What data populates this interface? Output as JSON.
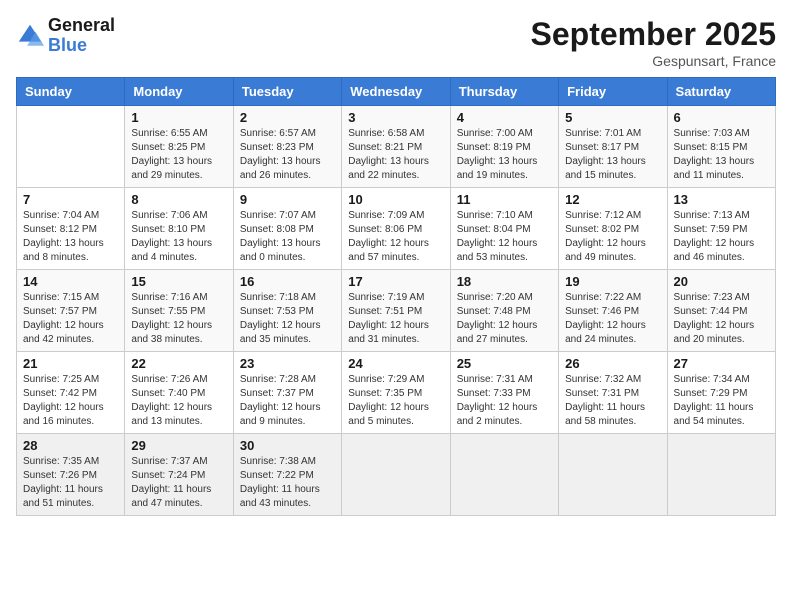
{
  "logo": {
    "text_general": "General",
    "text_blue": "Blue"
  },
  "title": "September 2025",
  "location": "Gespunsart, France",
  "weekdays": [
    "Sunday",
    "Monday",
    "Tuesday",
    "Wednesday",
    "Thursday",
    "Friday",
    "Saturday"
  ],
  "weeks": [
    [
      {
        "day": "",
        "sunrise": "",
        "sunset": "",
        "daylight": ""
      },
      {
        "day": "1",
        "sunrise": "Sunrise: 6:55 AM",
        "sunset": "Sunset: 8:25 PM",
        "daylight": "Daylight: 13 hours and 29 minutes."
      },
      {
        "day": "2",
        "sunrise": "Sunrise: 6:57 AM",
        "sunset": "Sunset: 8:23 PM",
        "daylight": "Daylight: 13 hours and 26 minutes."
      },
      {
        "day": "3",
        "sunrise": "Sunrise: 6:58 AM",
        "sunset": "Sunset: 8:21 PM",
        "daylight": "Daylight: 13 hours and 22 minutes."
      },
      {
        "day": "4",
        "sunrise": "Sunrise: 7:00 AM",
        "sunset": "Sunset: 8:19 PM",
        "daylight": "Daylight: 13 hours and 19 minutes."
      },
      {
        "day": "5",
        "sunrise": "Sunrise: 7:01 AM",
        "sunset": "Sunset: 8:17 PM",
        "daylight": "Daylight: 13 hours and 15 minutes."
      },
      {
        "day": "6",
        "sunrise": "Sunrise: 7:03 AM",
        "sunset": "Sunset: 8:15 PM",
        "daylight": "Daylight: 13 hours and 11 minutes."
      }
    ],
    [
      {
        "day": "7",
        "sunrise": "Sunrise: 7:04 AM",
        "sunset": "Sunset: 8:12 PM",
        "daylight": "Daylight: 13 hours and 8 minutes."
      },
      {
        "day": "8",
        "sunrise": "Sunrise: 7:06 AM",
        "sunset": "Sunset: 8:10 PM",
        "daylight": "Daylight: 13 hours and 4 minutes."
      },
      {
        "day": "9",
        "sunrise": "Sunrise: 7:07 AM",
        "sunset": "Sunset: 8:08 PM",
        "daylight": "Daylight: 13 hours and 0 minutes."
      },
      {
        "day": "10",
        "sunrise": "Sunrise: 7:09 AM",
        "sunset": "Sunset: 8:06 PM",
        "daylight": "Daylight: 12 hours and 57 minutes."
      },
      {
        "day": "11",
        "sunrise": "Sunrise: 7:10 AM",
        "sunset": "Sunset: 8:04 PM",
        "daylight": "Daylight: 12 hours and 53 minutes."
      },
      {
        "day": "12",
        "sunrise": "Sunrise: 7:12 AM",
        "sunset": "Sunset: 8:02 PM",
        "daylight": "Daylight: 12 hours and 49 minutes."
      },
      {
        "day": "13",
        "sunrise": "Sunrise: 7:13 AM",
        "sunset": "Sunset: 7:59 PM",
        "daylight": "Daylight: 12 hours and 46 minutes."
      }
    ],
    [
      {
        "day": "14",
        "sunrise": "Sunrise: 7:15 AM",
        "sunset": "Sunset: 7:57 PM",
        "daylight": "Daylight: 12 hours and 42 minutes."
      },
      {
        "day": "15",
        "sunrise": "Sunrise: 7:16 AM",
        "sunset": "Sunset: 7:55 PM",
        "daylight": "Daylight: 12 hours and 38 minutes."
      },
      {
        "day": "16",
        "sunrise": "Sunrise: 7:18 AM",
        "sunset": "Sunset: 7:53 PM",
        "daylight": "Daylight: 12 hours and 35 minutes."
      },
      {
        "day": "17",
        "sunrise": "Sunrise: 7:19 AM",
        "sunset": "Sunset: 7:51 PM",
        "daylight": "Daylight: 12 hours and 31 minutes."
      },
      {
        "day": "18",
        "sunrise": "Sunrise: 7:20 AM",
        "sunset": "Sunset: 7:48 PM",
        "daylight": "Daylight: 12 hours and 27 minutes."
      },
      {
        "day": "19",
        "sunrise": "Sunrise: 7:22 AM",
        "sunset": "Sunset: 7:46 PM",
        "daylight": "Daylight: 12 hours and 24 minutes."
      },
      {
        "day": "20",
        "sunrise": "Sunrise: 7:23 AM",
        "sunset": "Sunset: 7:44 PM",
        "daylight": "Daylight: 12 hours and 20 minutes."
      }
    ],
    [
      {
        "day": "21",
        "sunrise": "Sunrise: 7:25 AM",
        "sunset": "Sunset: 7:42 PM",
        "daylight": "Daylight: 12 hours and 16 minutes."
      },
      {
        "day": "22",
        "sunrise": "Sunrise: 7:26 AM",
        "sunset": "Sunset: 7:40 PM",
        "daylight": "Daylight: 12 hours and 13 minutes."
      },
      {
        "day": "23",
        "sunrise": "Sunrise: 7:28 AM",
        "sunset": "Sunset: 7:37 PM",
        "daylight": "Daylight: 12 hours and 9 minutes."
      },
      {
        "day": "24",
        "sunrise": "Sunrise: 7:29 AM",
        "sunset": "Sunset: 7:35 PM",
        "daylight": "Daylight: 12 hours and 5 minutes."
      },
      {
        "day": "25",
        "sunrise": "Sunrise: 7:31 AM",
        "sunset": "Sunset: 7:33 PM",
        "daylight": "Daylight: 12 hours and 2 minutes."
      },
      {
        "day": "26",
        "sunrise": "Sunrise: 7:32 AM",
        "sunset": "Sunset: 7:31 PM",
        "daylight": "Daylight: 11 hours and 58 minutes."
      },
      {
        "day": "27",
        "sunrise": "Sunrise: 7:34 AM",
        "sunset": "Sunset: 7:29 PM",
        "daylight": "Daylight: 11 hours and 54 minutes."
      }
    ],
    [
      {
        "day": "28",
        "sunrise": "Sunrise: 7:35 AM",
        "sunset": "Sunset: 7:26 PM",
        "daylight": "Daylight: 11 hours and 51 minutes."
      },
      {
        "day": "29",
        "sunrise": "Sunrise: 7:37 AM",
        "sunset": "Sunset: 7:24 PM",
        "daylight": "Daylight: 11 hours and 47 minutes."
      },
      {
        "day": "30",
        "sunrise": "Sunrise: 7:38 AM",
        "sunset": "Sunset: 7:22 PM",
        "daylight": "Daylight: 11 hours and 43 minutes."
      },
      {
        "day": "",
        "sunrise": "",
        "sunset": "",
        "daylight": ""
      },
      {
        "day": "",
        "sunrise": "",
        "sunset": "",
        "daylight": ""
      },
      {
        "day": "",
        "sunrise": "",
        "sunset": "",
        "daylight": ""
      },
      {
        "day": "",
        "sunrise": "",
        "sunset": "",
        "daylight": ""
      }
    ]
  ]
}
